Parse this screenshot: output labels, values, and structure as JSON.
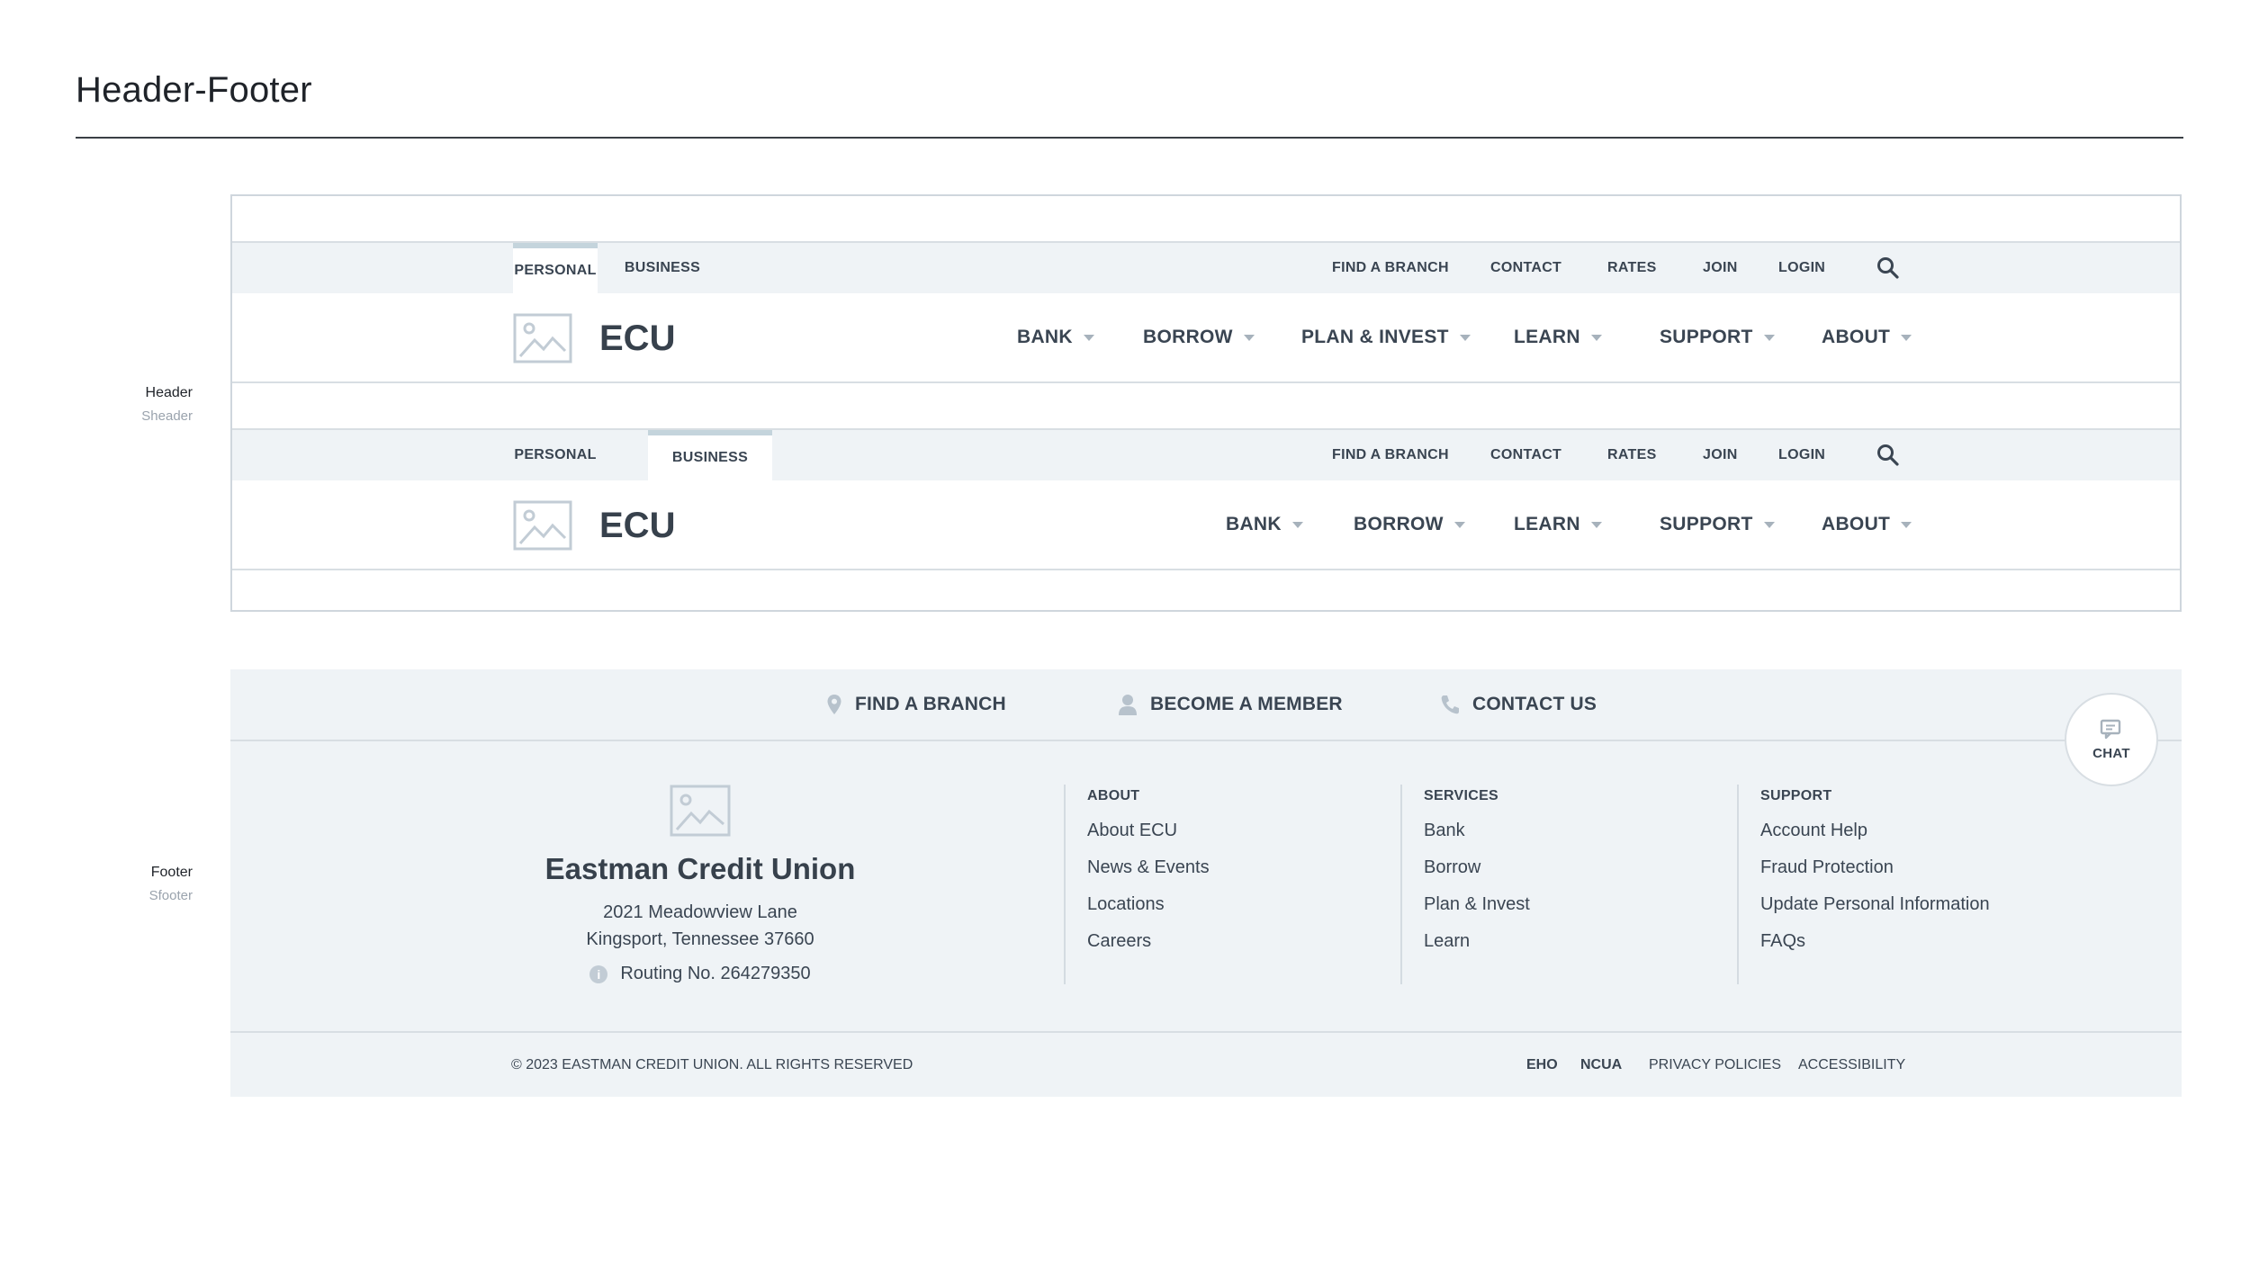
{
  "page": {
    "title": "Header-Footer"
  },
  "labels": {
    "header": {
      "main": "Header",
      "sub": "Sheader"
    },
    "footer": {
      "main": "Footer",
      "sub": "Sfooter"
    }
  },
  "header_variant_personal": {
    "tabs": [
      "PERSONAL",
      "BUSINESS"
    ],
    "active_tab": "PERSONAL",
    "utility_links": [
      "FIND A BRANCH",
      "CONTACT",
      "RATES",
      "JOIN",
      "LOGIN"
    ],
    "search_icon": "search-icon",
    "logo_text": "ECU",
    "nav": [
      "BANK",
      "BORROW",
      "PLAN & INVEST",
      "LEARN",
      "SUPPORT",
      "ABOUT"
    ]
  },
  "header_variant_business": {
    "tabs": [
      "PERSONAL",
      "BUSINESS"
    ],
    "active_tab": "BUSINESS",
    "utility_links": [
      "FIND A BRANCH",
      "CONTACT",
      "RATES",
      "JOIN",
      "LOGIN"
    ],
    "search_icon": "search-icon",
    "logo_text": "ECU",
    "nav": [
      "BANK",
      "BORROW",
      "LEARN",
      "SUPPORT",
      "ABOUT"
    ]
  },
  "footer": {
    "cta": [
      {
        "label": "FIND A BRANCH",
        "icon": "location-pin-icon"
      },
      {
        "label": "BECOME A MEMBER",
        "icon": "person-icon"
      },
      {
        "label": "CONTACT US",
        "icon": "phone-icon"
      }
    ],
    "chat_label": "CHAT",
    "brand": {
      "name": "Eastman Credit Union",
      "address_line1": "2021 Meadowview Lane",
      "address_line2": "Kingsport, Tennessee 37660",
      "routing": "Routing No. 264279350"
    },
    "columns": [
      {
        "heading": "ABOUT",
        "links": [
          "About ECU",
          "News & Events",
          "Locations",
          "Careers"
        ]
      },
      {
        "heading": "SERVICES",
        "links": [
          "Bank",
          "Borrow",
          "Plan & Invest",
          "Learn"
        ]
      },
      {
        "heading": "SUPPORT",
        "links": [
          "Account Help",
          "Fraud Protection",
          "Update Personal Information",
          "FAQs"
        ]
      }
    ],
    "copyright": "© 2023 EASTMAN CREDIT UNION. ALL RIGHTS RESERVED",
    "legal_links": [
      "EHO",
      "NCUA",
      "PRIVACY POLICIES",
      "ACCESSIBILITY"
    ]
  },
  "colors": {
    "bar_bg": "#eff3f6",
    "text": "#3a4552",
    "accent_tab": "#c4d4dc",
    "border": "#d8dee3"
  }
}
